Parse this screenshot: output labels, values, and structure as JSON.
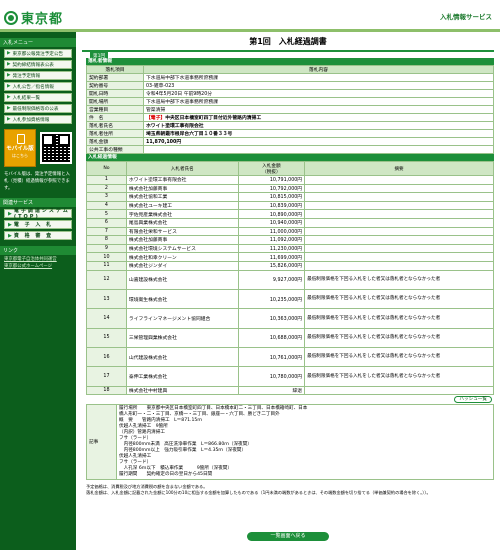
{
  "header": {
    "logo_text": "東京都",
    "service_title": "入札情報サービス"
  },
  "sidebar": {
    "section1": "入札メニュー",
    "menu": [
      "東京都公報発注予定公告",
      "契約締結情報表公表",
      "発注予定情報",
      "入札公告／指名情報",
      "入札結果一覧",
      "最低制限価格等の公表",
      "入札参加資格情報"
    ],
    "mobile_label": "モバイル版",
    "mobile_sub": "はこちら",
    "mobile_note": "モバイル版は、発注予定情報と入札（見積）経過情報が参照できます。",
    "section2": "関連サービス",
    "links": [
      "電子調達システム(TOP)",
      "電 子 入 札",
      "資 格 審 査"
    ],
    "section3": "リンク",
    "plain_links": [
      "東京都電子自治体共同運営",
      "東京都公式ホームページ"
    ]
  },
  "main": {
    "page_title": "第1回　入札経過調書",
    "tab_label": "第1回",
    "info_section": "落札者情報",
    "info_headers": [
      "落札項目",
      "落札内容"
    ],
    "info_rows": [
      {
        "k": "契約部署",
        "v": "下水道局中部下水道事務所庶務課"
      },
      {
        "k": "契約番号",
        "v": "03-雑草-023"
      },
      {
        "k": "開札日時",
        "v": "令和4年5月20日 午前9時20分"
      },
      {
        "k": "開札場所",
        "v": "下水道局中部下水道事務所庶務課"
      },
      {
        "k": "営業種目",
        "v": "管渠清掃"
      },
      {
        "k": "件　名",
        "tag": "【電子】",
        "v": "中央区日本橋室町四丁目付近外管路内清掃工"
      },
      {
        "k": "落札者氏名",
        "v": "ホワイト塗環工事有限会社"
      },
      {
        "k": "落札者住所",
        "v": "埼玉県朝霞市根岸台六丁目１０番３３号"
      },
      {
        "k": "落札金額",
        "v": "11,870,100円"
      },
      {
        "k": "公共工事の種類",
        "v": ""
      }
    ],
    "progress_section": "入札経過情報",
    "progress_headers": {
      "no": "No",
      "name": "入札者氏名",
      "amount": "入札金額",
      "amount_sub": "（税抜）",
      "remarks": "摘要"
    },
    "progress_rows": [
      {
        "no": "1",
        "name": "ホワイト塗環工事有限会社",
        "amount": "10,791,000円",
        "remarks": ""
      },
      {
        "no": "2",
        "name": "株式会社加藤商事",
        "amount": "10,792,000円",
        "remarks": ""
      },
      {
        "no": "3",
        "name": "株式会社協和工業",
        "amount": "10,815,000円",
        "remarks": ""
      },
      {
        "no": "4",
        "name": "株式会社ユーキ建工",
        "amount": "10,839,000円",
        "remarks": ""
      },
      {
        "no": "5",
        "name": "宇佐見産業株式会社",
        "amount": "10,890,000円",
        "remarks": ""
      },
      {
        "no": "6",
        "name": "尾島興業株式会社",
        "amount": "10,940,000円",
        "remarks": ""
      },
      {
        "no": "7",
        "name": "有限会社栄和サービス",
        "amount": "11,000,000円",
        "remarks": ""
      },
      {
        "no": "8",
        "name": "株式会社加藤商事",
        "amount": "11,092,000円",
        "remarks": ""
      },
      {
        "no": "9",
        "name": "株式会社環境システムサービス",
        "amount": "11,230,000円",
        "remarks": ""
      },
      {
        "no": "10",
        "name": "株式会社和幸クリーン",
        "amount": "11,699,000円",
        "remarks": ""
      },
      {
        "no": "11",
        "name": "株式会社ジンダイ",
        "amount": "15,826,000円",
        "remarks": ""
      },
      {
        "no": "12",
        "name": "山嘉建設株式会社",
        "amount": "9,927,000円",
        "remarks": "最低制限価格を下回る入札をした者又は落札者とならなかった者",
        "tall": true
      },
      {
        "no": "13",
        "name": "環境衛生株式会社",
        "amount": "10,235,000円",
        "remarks": "最低制限価格を下回る入札をした者又は落札者とならなかった者",
        "tall": true
      },
      {
        "no": "14",
        "name": "ライフラインマネージメント協同組合",
        "amount": "10,363,000円",
        "remarks": "最低制限価格を下回る入札をした者又は落札者とならなかった者",
        "tall": true
      },
      {
        "no": "15",
        "name": "三栄管理興業株式会社",
        "amount": "10,688,000円",
        "remarks": "最低制限価格を下回る入札をした者又は落札者とならなかった者",
        "tall": true
      },
      {
        "no": "16",
        "name": "山代建設株式会社",
        "amount": "10,761,000円",
        "remarks": "最低制限価格を下回る入札をした者又は落札者とならなかった者",
        "tall": true
      },
      {
        "no": "17",
        "name": "泰伸工業株式会社",
        "amount": "10,780,000円",
        "remarks": "最低制限価格を下回る入札をした者又は落札者とならなかった者",
        "tall": true
      },
      {
        "no": "18",
        "name": "株式会社中村建興",
        "amount": "辞退",
        "remarks": ""
      }
    ],
    "list_button": "ハッシュ一覧",
    "notes_label": "記事",
    "notes_lines": [
      "履行場所　　東京都中央区日本橋室町四丁目、日本橋本町二・三丁目、日本橋箱崎町、日本",
      "橋人形町一・二・三丁目、京橋一・三丁目、銀座一・六丁目、勝どき二丁目外",
      "概　要　　管路内清掃工　L＝871.15ｍ",
      "伏越人孔清掃工　9箇所",
      "（内訳）管路内清掃工",
      "フサ（ラード）",
      "　内径800mm未満　高圧洗浄車作業　L＝866.80ｍ（深夜間）",
      "　内径800mm以上　強力吸引車作業　L＝4.35ｍ（深夜間）",
      "伏越人孔清掃工",
      "フサ（ラード）",
      "　人孔深 6ｍ以下　積込車作業　　　9箇所（深夜間）",
      "履行期間　　契約確定の日の翌日から45日間"
    ],
    "footnotes": [
      "予定価格は、消費税及び地方消費税の額を含まない金額である。",
      "落札金額は、入札金額に記載された金額に100分の10に相当する金額を加算したものである（1円未満の端数があるときは、その端数金額を切り捨てる（単価兼契約の場合を除く。））。"
    ],
    "back_button": "一覧画面へ戻る"
  }
}
